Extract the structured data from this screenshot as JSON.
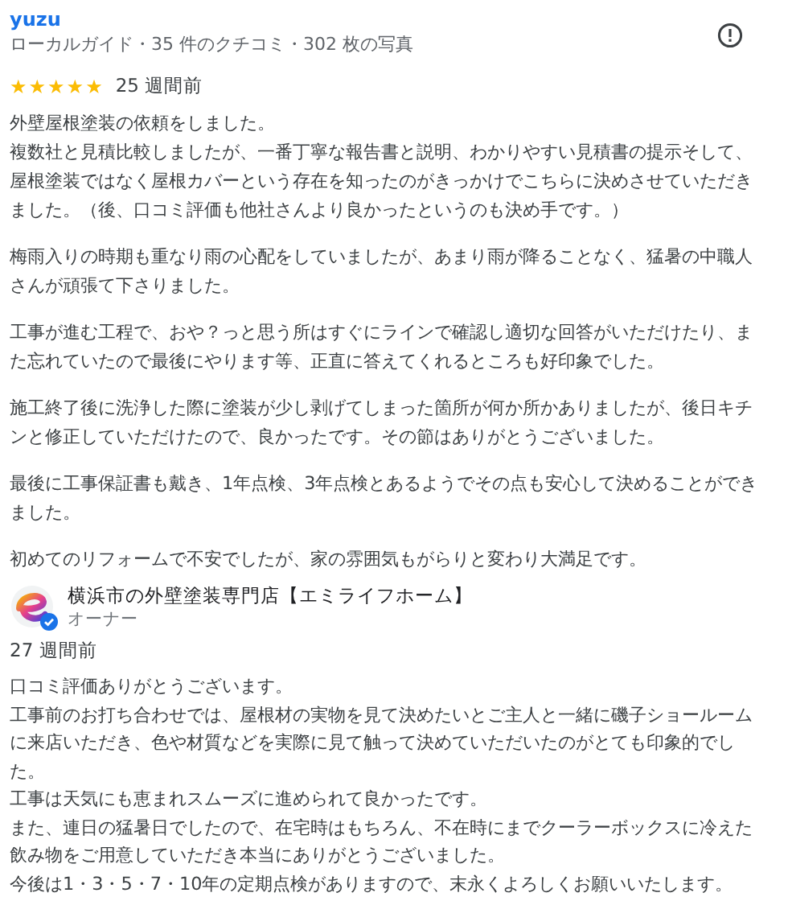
{
  "review": {
    "author": "yuzu",
    "meta": "ローカルガイド・35 件のクチコミ・302 枚の写真",
    "stars": 5,
    "time": "25 週間前",
    "paragraphs": [
      "外壁屋根塗装の依頼をしました。",
      "複数社と見積比較しましたが、一番丁寧な報告書と説明、わかりやすい見積書の提示そして、屋根塗装ではなく屋根カバーという存在を知ったのがきっかけでこちらに決めさせていただきました。（後、口コミ評価も他社さんより良かったというのも決め手です。）",
      "梅雨入りの時期も重なり雨の心配をしていましたが、あまり雨が降ることなく、猛暑の中職人さんが頑張て下さりました。",
      "工事が進む工程で、おや？っと思う所はすぐにラインで確認し適切な回答がいただけたり、また忘れていたので最後にやります等、正直に答えてくれるところも好印象でした。",
      "施工終了後に洗浄した際に塗装が少し剥げてしまった箇所が何か所かありましたが、後日キチンと修正していただけたので、良かったです。その節はありがとうございました。",
      "最後に工事保証書も戴き、1年点検、3年点検とあるようでその点も安心して決めることができました。",
      "初めてのリフォームで不安でしたが、家の雰囲気もがらりと変わり大満足です。"
    ]
  },
  "owner_reply": {
    "name": "横浜市の外壁塗装専門店【エミライフホーム】",
    "role": "オーナー",
    "verified": true,
    "time": "27 週間前",
    "lines": [
      "口コミ評価ありがとうございます。",
      "工事前のお打ち合わせでは、屋根材の実物を見て決めたいとご主人と一緒に磯子ショールームに来店いただき、色や材質などを実際に見て触って決めていただいたのがとても印象的でした。",
      "工事は天気にも恵まれスムーズに進められて良かったです。",
      "また、連日の猛暑日でしたので、在宅時はもちろん、不在時にまでクーラーボックスに冷えた飲み物をご用意していただき本当にありがとうございました。",
      "今後は1・3・5・7・10年の定期点検がありますので、末永くよろしくお願いいたします。"
    ]
  }
}
